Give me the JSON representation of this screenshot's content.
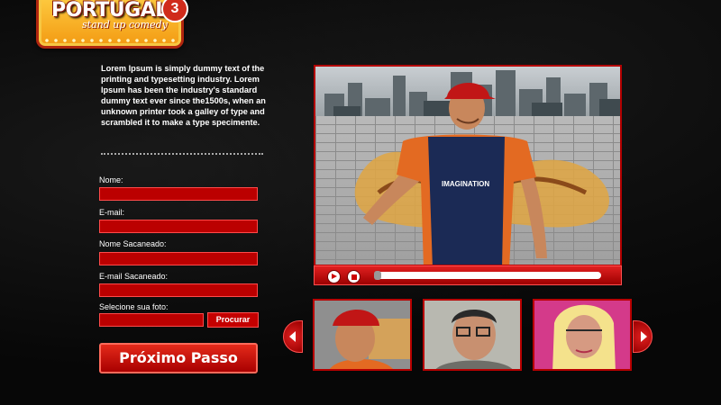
{
  "logo": {
    "title": "PORTUGAL",
    "subtitle": "stand up comedy",
    "badge": "3"
  },
  "intro_text": "Lorem Ipsum is simply dummy text of the printing and typesetting industry. Lorem Ipsum has been the industry's standard dummy text ever since the1500s, when an unknown printer took a galley of type and scrambled it to make a type specimente.",
  "form": {
    "name_label": "Nome:",
    "name_value": "",
    "email_label": "E-mail:",
    "email_value": "",
    "target_name_label": "Nome Sacaneado:",
    "target_name_value": "",
    "target_email_label": "E-mail Sacaneado:",
    "target_email_value": "",
    "photo_label": "Selecione sua foto:",
    "photo_value": "",
    "browse_label": "Procurar",
    "next_label": "Próximo Passo"
  },
  "video": {
    "shirt_text": "IMAGINATION",
    "progress": 0.0,
    "play_icon": "play-icon",
    "stop_icon": "stop-icon"
  },
  "thumbnails": [
    {
      "name": "thumbnail-comedian-cap"
    },
    {
      "name": "thumbnail-comedian-glasses"
    },
    {
      "name": "thumbnail-comedian-wig"
    }
  ],
  "colors": {
    "accent": "#c00000",
    "background": "#070707",
    "logo_yellow": "#ffd54a"
  }
}
